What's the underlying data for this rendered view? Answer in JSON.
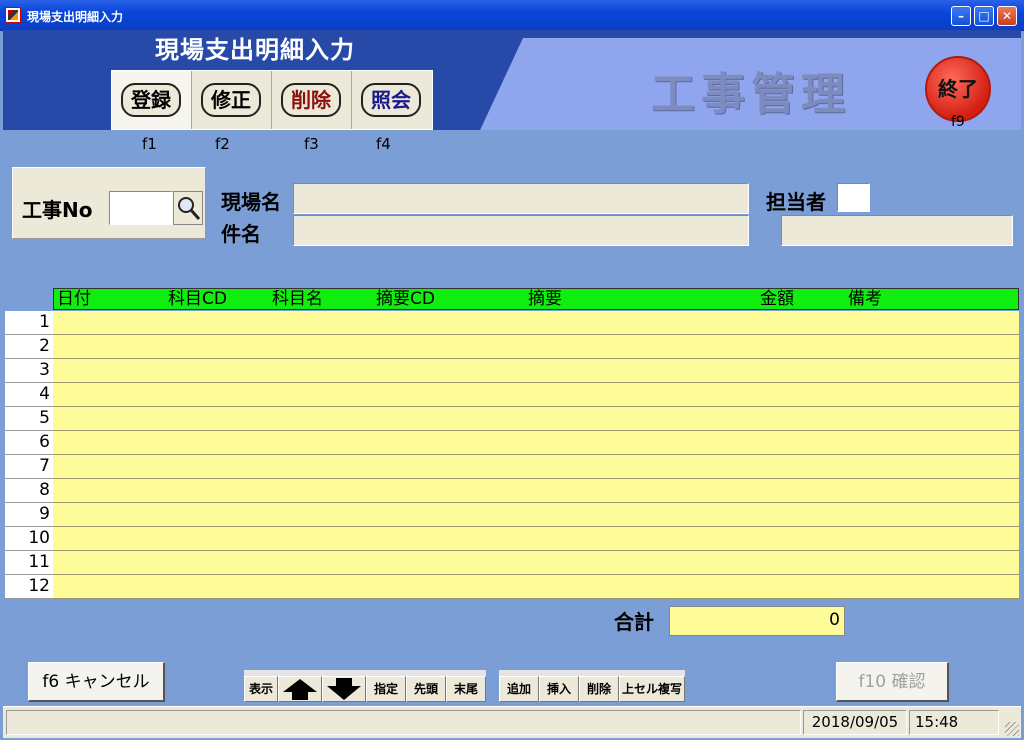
{
  "window": {
    "title": "現場支出明細入力"
  },
  "header": {
    "app_title": "現場支出明細入力",
    "brand": "工事管理",
    "exit_label": "終了",
    "exit_key": "f9",
    "buttons": [
      {
        "label": "登録",
        "key": "f1",
        "color": "#000000"
      },
      {
        "label": "修正",
        "key": "f2",
        "color": "#000000"
      },
      {
        "label": "削除",
        "key": "f3",
        "color": "#8b1010"
      },
      {
        "label": "照会",
        "key": "f4",
        "color": "#1a1a8b"
      }
    ]
  },
  "form": {
    "koji_no_label": "工事No",
    "koji_no_value": "",
    "genba_label": "現場名",
    "genba_value": "",
    "kenmei_label": "件名",
    "kenmei_value": "",
    "tanto_label": "担当者",
    "tanto_code": "",
    "tanto_name": ""
  },
  "grid": {
    "columns": [
      "日付",
      "科目CD",
      "科目名",
      "摘要CD",
      "摘要",
      "金額",
      "備考"
    ],
    "rows": [
      "1",
      "2",
      "3",
      "4",
      "5",
      "6",
      "7",
      "8",
      "9",
      "10",
      "11",
      "12"
    ]
  },
  "total": {
    "label": "合計",
    "value": "0"
  },
  "footer": {
    "cancel_label": "f6 キャンセル",
    "confirm_label": "f10 確認",
    "nav_buttons": {
      "show": "表示",
      "specify": "指定",
      "first": "先頭",
      "last": "末尾"
    },
    "row_buttons": {
      "add": "追加",
      "insert": "挿入",
      "delete": "削除",
      "copy": "上セル複写"
    }
  },
  "status": {
    "date": "2018/09/05",
    "time": "15:48"
  },
  "colors": {
    "header_bg": "#274aa8",
    "grid_header": "#10ee10",
    "grid_row": "#fdfc99",
    "background": "#7c9ed6"
  }
}
